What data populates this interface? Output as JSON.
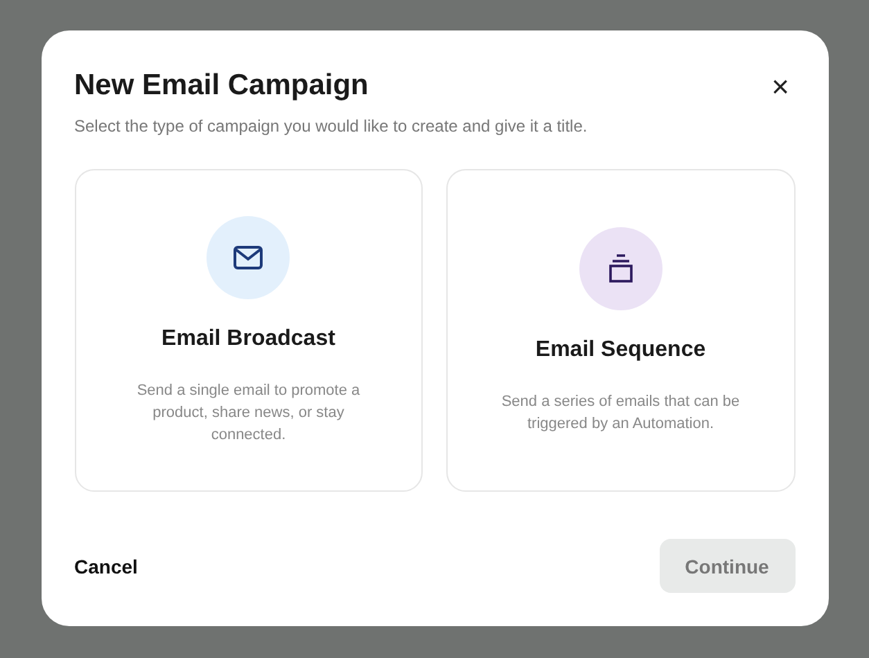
{
  "dialog": {
    "title": "New Email Campaign",
    "subtitle": "Select the type of campaign you would like to create and give it a title.",
    "close": "×",
    "options": [
      {
        "kind": "envelope",
        "color": "#e3f0fc",
        "title": "Email Broadcast",
        "description": "Send a single email to promote a product, share news, or stay connected.",
        "selected": false
      },
      {
        "kind": "stack",
        "color": "#ebe2f5",
        "title": "Email Sequence",
        "description": "Send a series of emails that can be triggered by an Automation.",
        "selected": false
      }
    ],
    "cancel": "Cancel",
    "continue": {
      "label": "Continue",
      "disabled": true
    }
  }
}
